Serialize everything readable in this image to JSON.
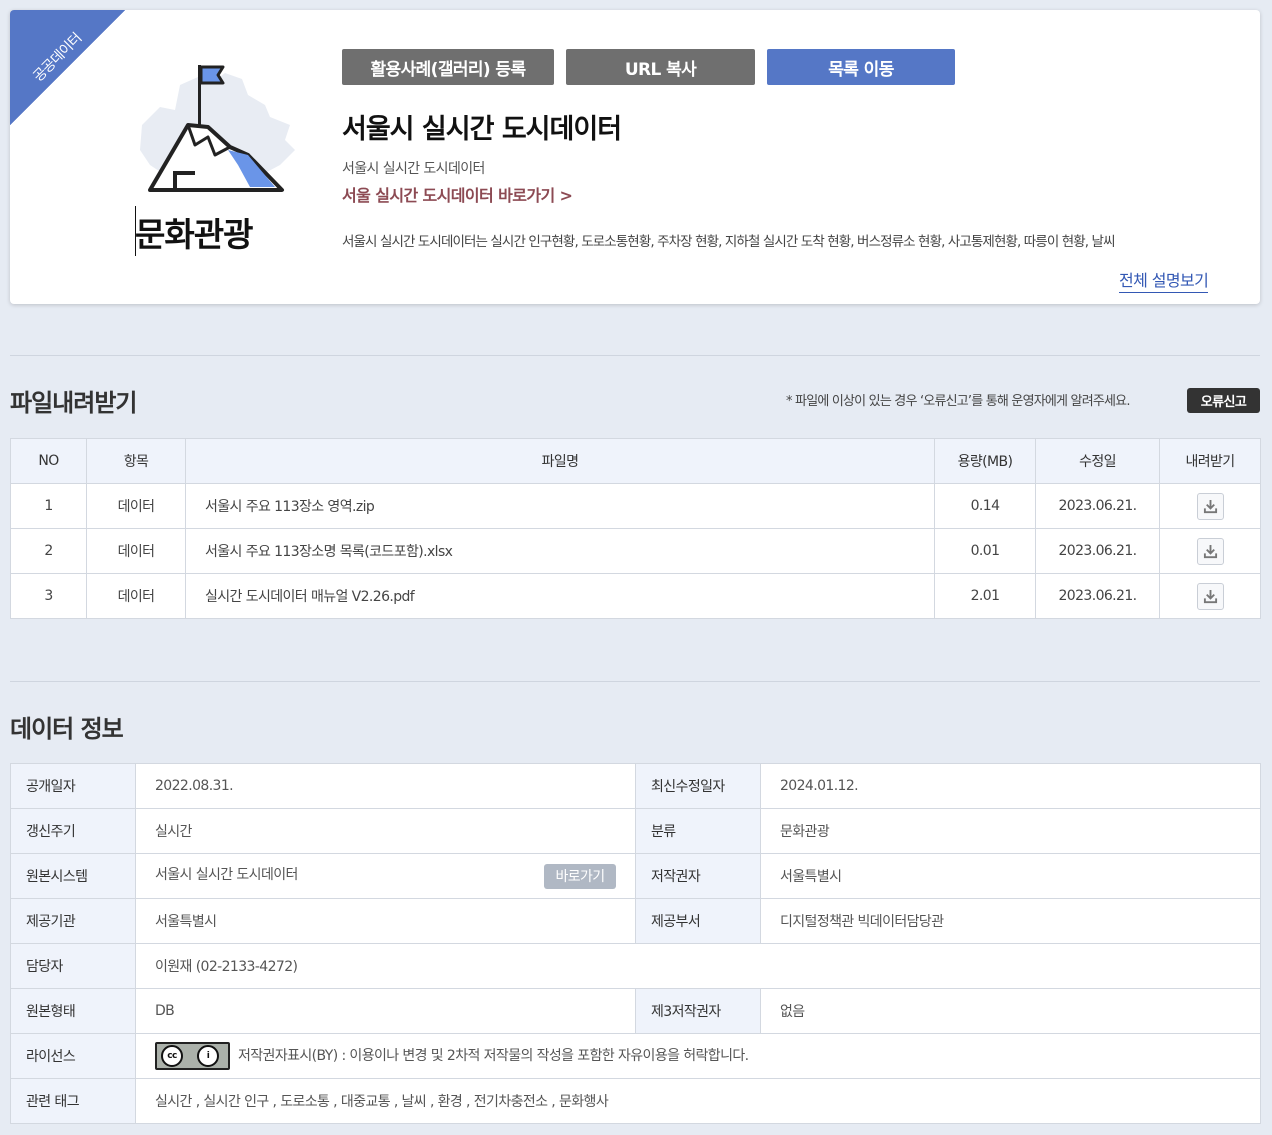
{
  "ribbon": "공공데이터",
  "category": "문화관광",
  "buttons": {
    "gallery": "활용사례(갤러리) 등록",
    "url_copy": "URL 복사",
    "list": "목록 이동"
  },
  "title": "서울시 실시간 도시데이터",
  "subtitle": "서울시 실시간 도시데이터",
  "go_link": "서울 실시간 도시데이터 바로가기 >",
  "description": "서울시 실시간 도시데이터는 실시간 인구현황, 도로소통현황, 주차장 현황, 지하철 실시간 도착 현황, 버스정류소 현황, 사고통제현황, 따릉이 현황, 날씨",
  "more": "전체 설명보기",
  "files_section": {
    "title": "파일내려받기",
    "notice": "* 파일에 이상이 있는 경우 ‘오류신고’를 통해 운영자에게 알려주세요.",
    "error_button": "오류신고",
    "headers": [
      "NO",
      "항목",
      "파일명",
      "용량(MB)",
      "수정일",
      "내려받기"
    ],
    "rows": [
      {
        "no": "1",
        "item": "데이터",
        "name": "서울시 주요 113장소 영역.zip",
        "size": "0.14",
        "date": "2023.06.21."
      },
      {
        "no": "2",
        "item": "데이터",
        "name": "서울시 주요 113장소명 목록(코드포함).xlsx",
        "size": "0.01",
        "date": "2023.06.21."
      },
      {
        "no": "3",
        "item": "데이터",
        "name": "실시간 도시데이터 매뉴얼 V2.26.pdf",
        "size": "2.01",
        "date": "2023.06.21."
      }
    ]
  },
  "info_section": {
    "title": "데이터 정보",
    "open_date_label": "공개일자",
    "open_date": "2022.08.31.",
    "updated_label": "최신수정일자",
    "updated": "2024.01.12.",
    "cycle_label": "갱신주기",
    "cycle": "실시간",
    "class_label": "분류",
    "class": "문화관광",
    "system_label": "원본시스템",
    "system": "서울시 실시간 도시데이터",
    "system_button": "바로가기",
    "author_label": "저작권자",
    "author": "서울특별시",
    "org_label": "제공기관",
    "org": "서울특별시",
    "dept_label": "제공부서",
    "dept": "디지털정책관 빅데이터담당관",
    "manager_label": "담당자",
    "manager": "이원재 (02-2133-4272)",
    "format_label": "원본형태",
    "format": "DB",
    "third_label": "제3저작권자",
    "third": "없음",
    "license_label": "라이선스",
    "license": "저작권자표시(BY) : 이용이나 변경 및 2차적 저작물의 작성을 포함한 자유이용을 허락합니다.",
    "tags_label": "관련 태그",
    "tags": "실시간 , 실시간 인구 , 도로소통 , 대중교통 , 날씨 , 환경 , 전기차충전소 , 문화행사"
  }
}
